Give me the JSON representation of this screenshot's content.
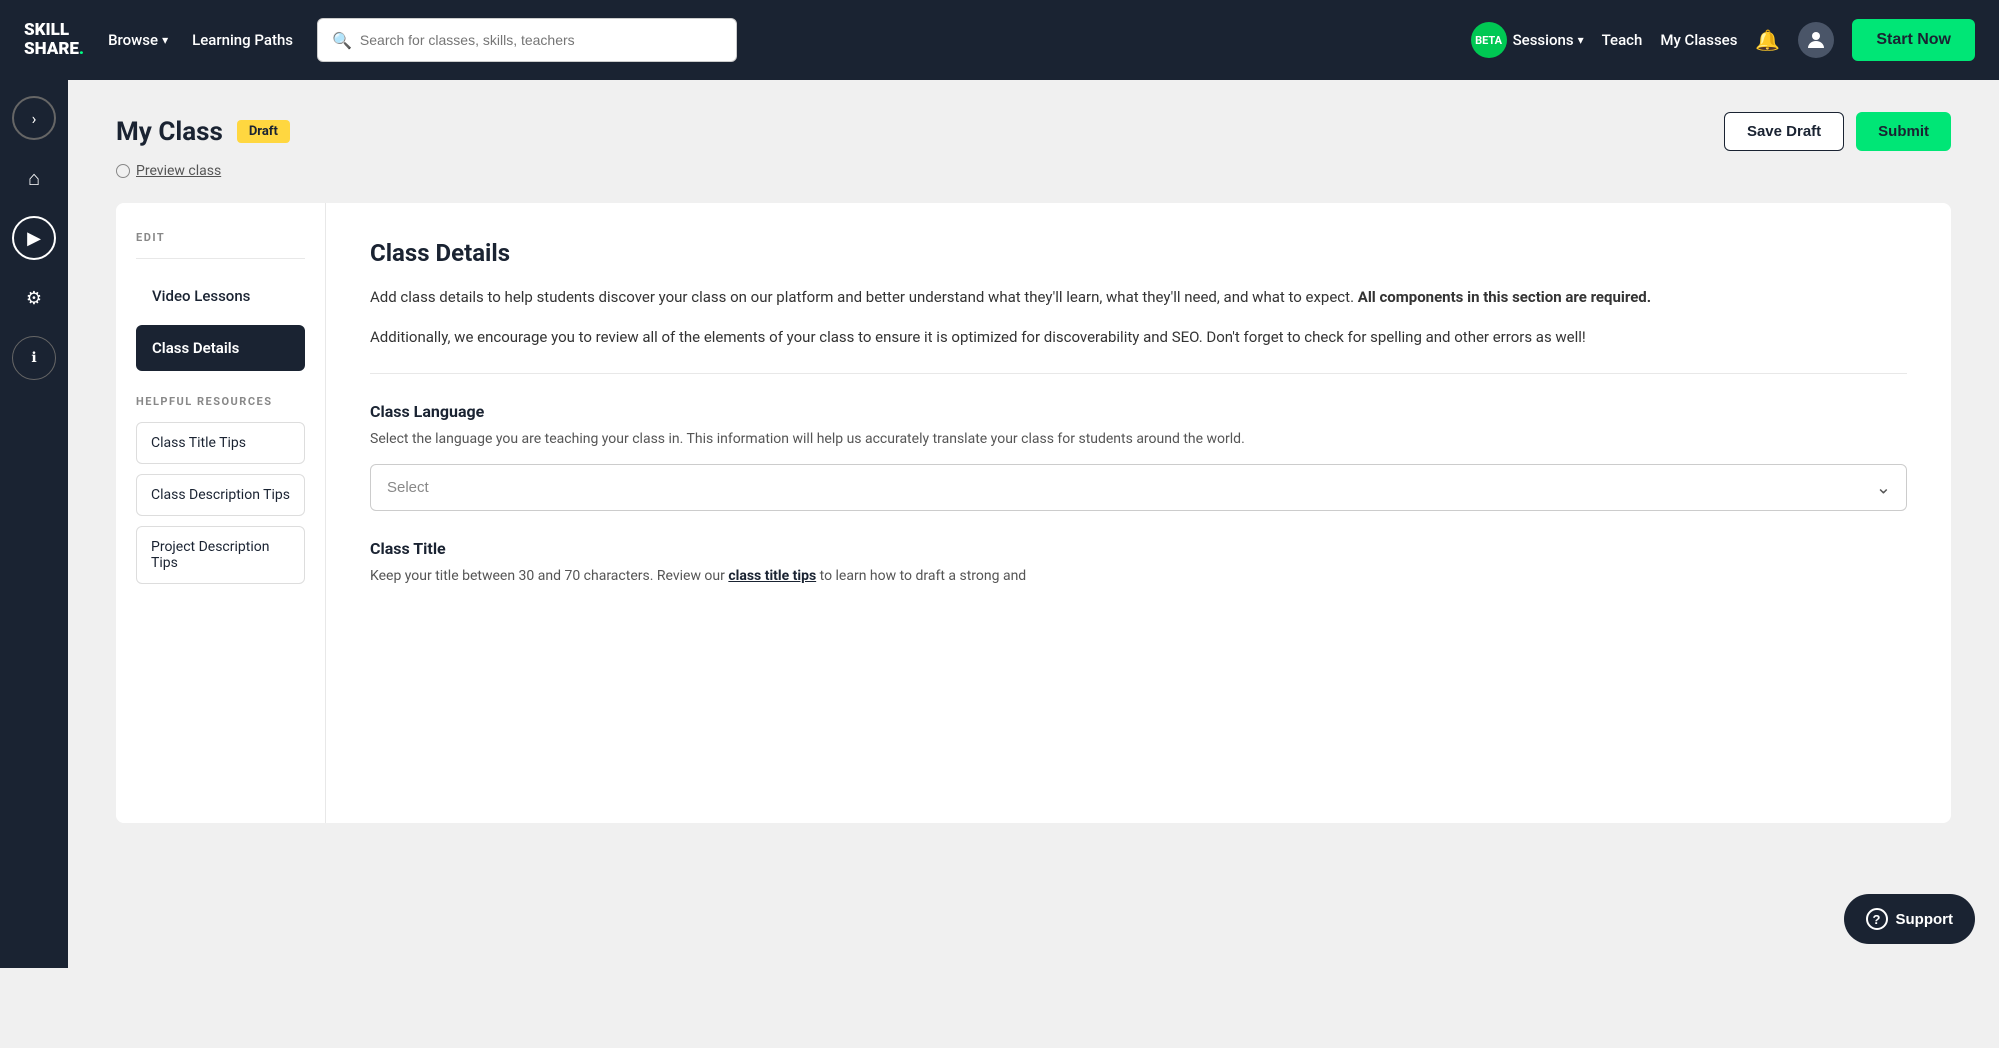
{
  "nav": {
    "logo_line1": "SKILL",
    "logo_line2": "SHaRe",
    "logo_dot": ".",
    "browse_label": "Browse",
    "learning_paths_label": "Learning Paths",
    "search_placeholder": "Search for classes, skills, teachers",
    "beta_label": "BETA",
    "sessions_label": "Sessions",
    "teach_label": "Teach",
    "my_classes_label": "My Classes",
    "start_now_label": "Start Now"
  },
  "sidebar": {
    "icons": [
      "›",
      "⌂",
      "▶",
      "⚙",
      "ℹ"
    ]
  },
  "page": {
    "title": "My Class",
    "draft_badge": "Draft",
    "save_draft_label": "Save Draft",
    "submit_label": "Submit",
    "preview_label": "Preview class"
  },
  "left_panel": {
    "edit_label": "EDIT",
    "video_lessons_label": "Video Lessons",
    "class_details_label": "Class Details",
    "resources_label": "HELPFUL RESOURCES",
    "resource_items": [
      "Class Title Tips",
      "Class Description Tips",
      "Project Description Tips"
    ]
  },
  "right_panel": {
    "section_title": "Class Details",
    "description_part1": "Add class details to help students discover your class on our platform and better understand what they'll learn, what they'll need, and what to expect. ",
    "description_bold": "All components in this section are required.",
    "description_part2": "Additionally, we encourage you to review all of the elements of your class to ensure it is optimized for discoverability and SEO. Don't forget to check for spelling and other errors as well!",
    "language_field_label": "Class Language",
    "language_field_desc": "Select the language you are teaching your class in. This information will help us accurately translate your class for students around the world.",
    "language_select_placeholder": "Select",
    "title_field_label": "Class Title",
    "title_field_desc_part1": "Keep your title between 30 and 70 characters. Review our ",
    "title_field_desc_link": "class title tips",
    "title_field_desc_part2": " to learn how to draft a strong and"
  },
  "support": {
    "label": "Support",
    "icon": "?"
  }
}
